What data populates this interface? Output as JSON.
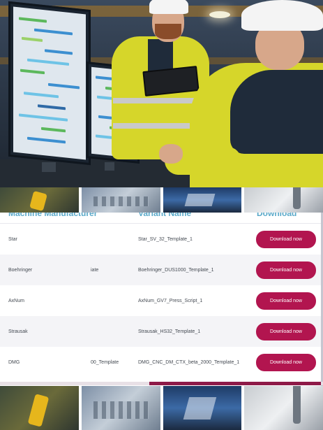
{
  "table": {
    "headers": {
      "manufacturer": "Machine Manufacturer",
      "variant": "Variant Name",
      "download": "Download"
    },
    "rows": [
      {
        "manufacturer": "Star",
        "middle": "",
        "variant": "Star_SV_32_Template_1",
        "button": "Download now"
      },
      {
        "manufacturer": "Boehringer",
        "middle": "iate",
        "variant": "Boehringer_DUS1000_Template_1",
        "button": "Download now"
      },
      {
        "manufacturer": "AxNum",
        "middle": "",
        "variant": "AxNum_GV7_Press_Script_1",
        "button": "Download now"
      },
      {
        "manufacturer": "Strausak",
        "middle": "",
        "variant": "Strausak_HS32_Template_1",
        "button": "Download now"
      },
      {
        "manufacturer": "DMG",
        "middle": "00_Template",
        "variant": "DMG_CNC_DM_CTX_beta_2000_Template_1",
        "button": "Download now"
      }
    ]
  },
  "icons": {
    "hero": "factory-photo",
    "thumbs": [
      "robot-arm-photo",
      "engine-photo",
      "factory-hall-photo",
      "drill-photo"
    ]
  },
  "colors": {
    "header_text": "#5aa9c9",
    "button_bg": "#b2154f",
    "scroll_thumb": "#8e1a48"
  }
}
